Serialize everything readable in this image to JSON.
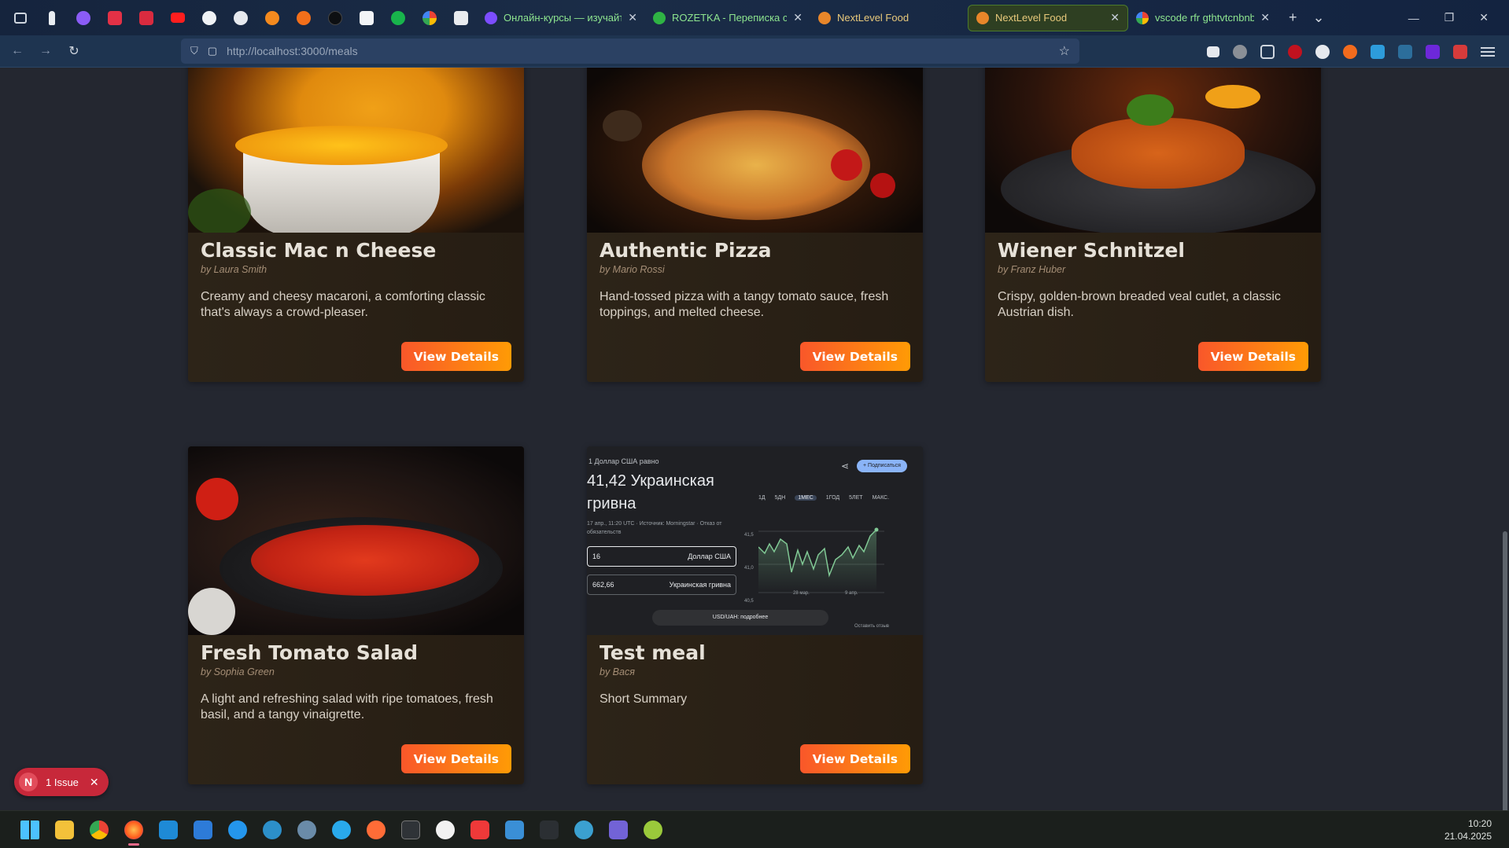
{
  "browser": {
    "tabs": [
      {
        "title": "Онлайн-курсы — изучайте",
        "favicon_color": "#7c4dff"
      },
      {
        "title": "ROZETKA - Переписка с пр",
        "favicon_color": "#2fb344"
      },
      {
        "title": "NextLevel Food",
        "favicon_color": "#e8862a"
      },
      {
        "title": "NextLevel Food",
        "favicon_color": "#e8862a",
        "active": true
      },
      {
        "title": "vscode rfr gthtvtcnbnbnm c",
        "favicon_color": "#4285f4"
      }
    ],
    "close_glyph": "✕",
    "new_tab_glyph": "+",
    "tab_list_glyph": "⌄",
    "url_host": "http://localhost",
    "url_path": ":3000/meals"
  },
  "meals": [
    {
      "title": "Classic Mac n Cheese",
      "creator": "by Laura Smith",
      "summary": "Creamy and cheesy macaroni, a comforting classic that's always a crowd-pleaser.",
      "button": "View Details",
      "image": "mac-n-cheese"
    },
    {
      "title": "Authentic Pizza",
      "creator": "by Mario Rossi",
      "summary": "Hand-tossed pizza with a tangy tomato sauce, fresh toppings, and melted cheese.",
      "button": "View Details",
      "image": "pizza"
    },
    {
      "title": "Wiener Schnitzel",
      "creator": "by Franz Huber",
      "summary": "Crispy, golden-brown breaded veal cutlet, a classic Austrian dish.",
      "button": "View Details",
      "image": "schnitzel"
    },
    {
      "title": "Fresh Tomato Salad",
      "creator": "by Sophia Green",
      "summary": "A light and refreshing salad with ripe tomatoes, fresh basil, and a tangy vinaigrette.",
      "button": "View Details",
      "image": "tomato-salad"
    },
    {
      "title": "Test meal",
      "creator": "by Вася",
      "summary": "Short Summary",
      "button": "View Details",
      "image": "currency-screenshot"
    }
  ],
  "screenshot_widget": {
    "line1": "1 Доллар США равно",
    "rate": "41,42 Украинская гривна",
    "note": "17 апр., 11:20 UTC · Источник: Morningstar · Отказ от обязательств",
    "share_btn": "+ Подписаться",
    "ranges": [
      "1Д",
      "5ДН",
      "1МЕС",
      "1ГОД",
      "5ЛЕТ",
      "МАКС."
    ],
    "amount1": "16",
    "currency1": "Доллар США",
    "amount2": "662,66",
    "currency2": "Украинская гривна",
    "y_ticks": [
      "41,5",
      "41,0",
      "40,5"
    ],
    "x_ticks": [
      "28 мар.",
      "9 апр."
    ],
    "more": "USD/UAH: подробнее",
    "feedback": "Оставить отзыв"
  },
  "issue_badge": {
    "letter": "N",
    "label": "1 Issue",
    "close": "✕"
  },
  "clock": {
    "time": "10:20",
    "date": "21.04.2025"
  }
}
